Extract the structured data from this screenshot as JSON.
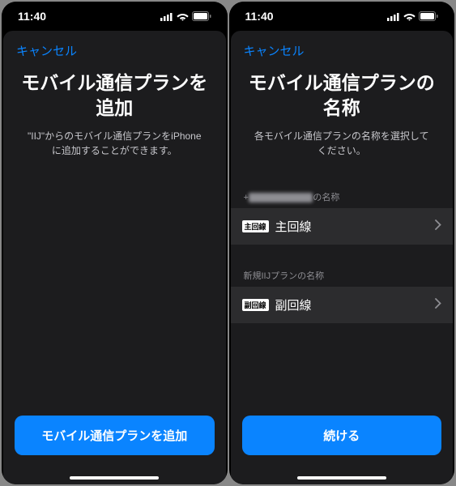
{
  "screens": [
    {
      "statusTime": "11:40",
      "cancel": "キャンセル",
      "title": "モバイル通信プランを追加",
      "subtitle": "\"IIJ\"からのモバイル通信プランをiPhoneに追加することができます。",
      "button": "モバイル通信プランを追加"
    },
    {
      "statusTime": "11:40",
      "cancel": "キャンセル",
      "title": "モバイル通信プランの名称",
      "subtitle": "各モバイル通信プランの名称を選択してください。",
      "sections": [
        {
          "headerPrefix": "+",
          "headerBlurred": "XX XXXX XXXX",
          "headerSuffix": "の名称",
          "badge": "主回線",
          "label": "主回線"
        },
        {
          "header": "新規IIJプランの名称",
          "badge": "副回線",
          "label": "副回線"
        }
      ],
      "button": "続ける"
    }
  ]
}
